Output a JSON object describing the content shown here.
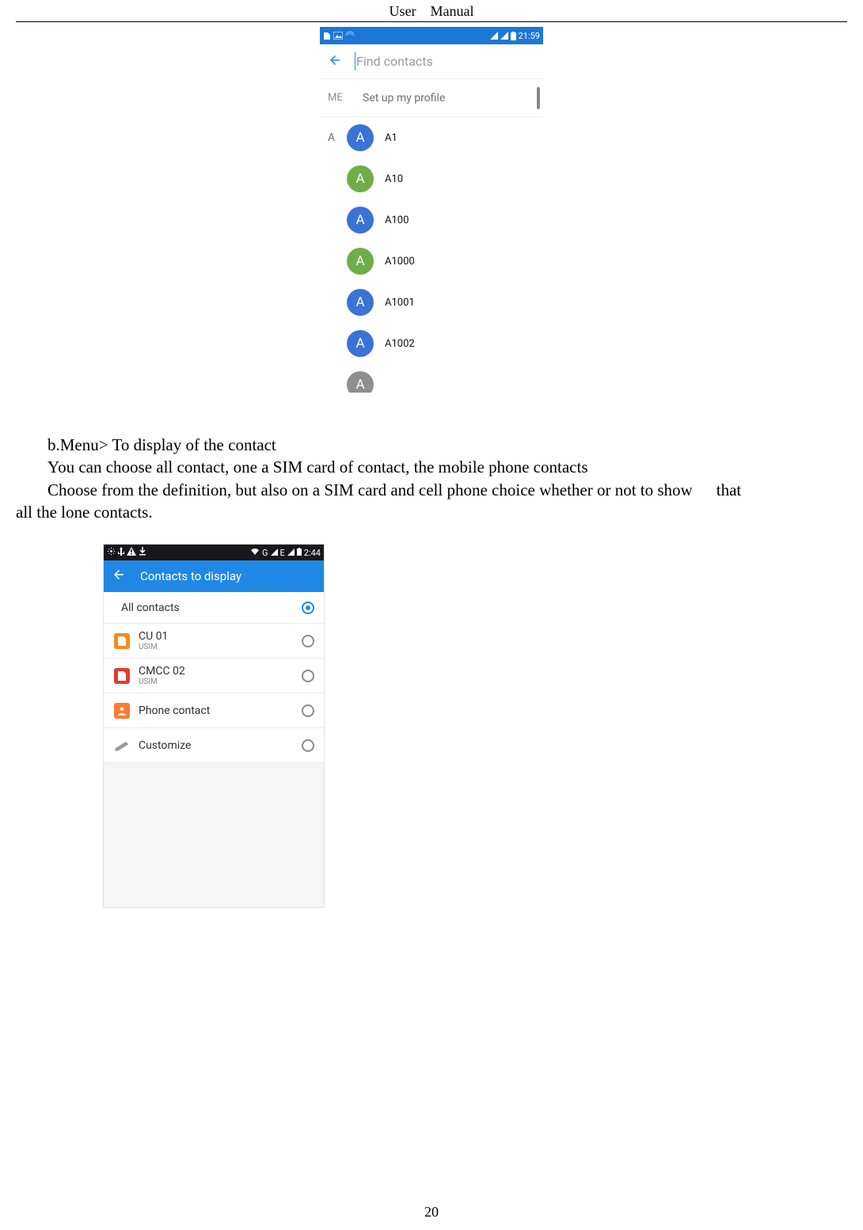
{
  "header": "User Manual",
  "footer": "20",
  "shot1": {
    "status_time": "21:59",
    "search_placeholder": "Find contacts",
    "me_label": "ME",
    "me_text": "Set up my profile",
    "group_letter": "A",
    "contacts": [
      {
        "name": "A1",
        "color": "c-blue"
      },
      {
        "name": "A10",
        "color": "c-green"
      },
      {
        "name": "A100",
        "color": "c-blue"
      },
      {
        "name": "A1000",
        "color": "c-green"
      },
      {
        "name": "A1001",
        "color": "c-blue"
      },
      {
        "name": "A1002",
        "color": "c-blue"
      },
      {
        "name": "",
        "color": "c-grey"
      }
    ],
    "avatar_letter": "A"
  },
  "body": {
    "l1": "b.Menu> To display of the contact",
    "l2": "You can choose all contact, one a SIM card of contact, the mobile phone contacts",
    "l3a": "Choose from the definition, but also on a SIM card and cell phone choice whether or not to show",
    "l3b": "that",
    "l4": "all the lone contacts."
  },
  "shot2": {
    "status_net": "G",
    "status_e": "E",
    "status_time": "2:44",
    "title": "Contacts to display",
    "options": [
      {
        "label": "All contacts",
        "sub": "",
        "icon": "none",
        "selected": true
      },
      {
        "label": "CU 01",
        "sub": "USIM",
        "icon": "sim-orange",
        "selected": false
      },
      {
        "label": "CMCC 02",
        "sub": "USIM",
        "icon": "sim-red",
        "selected": false
      },
      {
        "label": "Phone contact",
        "sub": "",
        "icon": "phone",
        "selected": false
      },
      {
        "label": "Customize",
        "sub": "",
        "icon": "pen",
        "selected": false
      }
    ]
  }
}
